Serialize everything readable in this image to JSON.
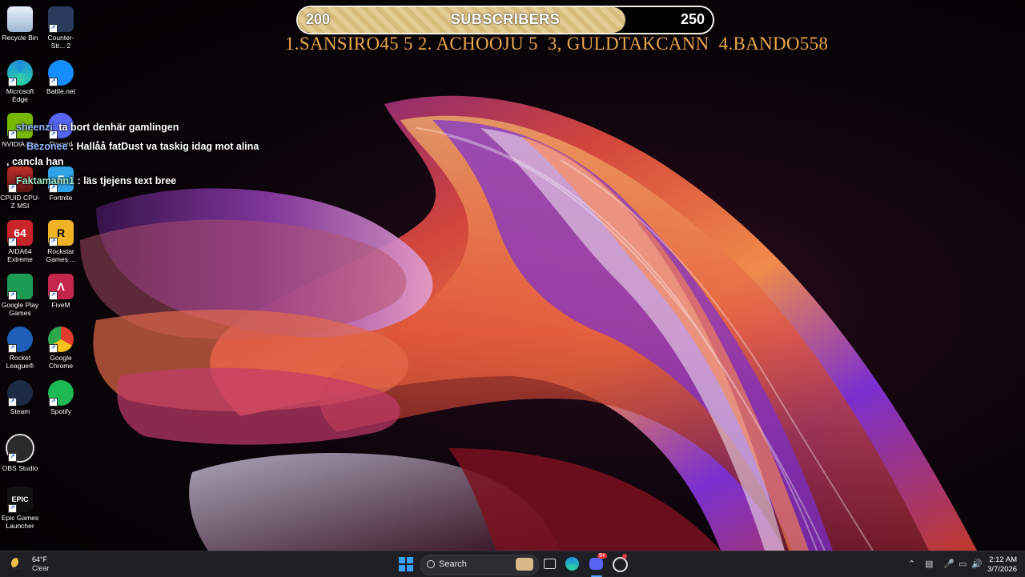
{
  "desktop_icons_left": [
    {
      "label": "Recycle Bin",
      "icon": "recycle-bin-icon"
    },
    {
      "label": "Microsoft Edge",
      "icon": "edge-icon"
    },
    {
      "label": "NVIDIA App",
      "icon": "nvidia-icon"
    },
    {
      "label": "CPUID CPU-Z MSI",
      "icon": "cpuz-icon"
    },
    {
      "label": "AIDA64 Extreme",
      "icon": "aida64-icon"
    },
    {
      "label": "Google Play Games",
      "icon": "google-play-games-icon"
    },
    {
      "label": "Rocket League®",
      "icon": "rocket-league-icon"
    },
    {
      "label": "Steam",
      "icon": "steam-icon"
    },
    {
      "label": "OBS Studio",
      "icon": "obs-icon"
    },
    {
      "label": "Epic Games Launcher",
      "icon": "epic-games-icon"
    }
  ],
  "desktop_icons_right": [
    {
      "label": "Counter-Str... 2",
      "icon": "counter-strike-icon"
    },
    {
      "label": "Battle.net",
      "icon": "battlenet-icon"
    },
    {
      "label": "Discord",
      "icon": "discord-icon"
    },
    {
      "label": "Fortnite",
      "icon": "fortnite-icon"
    },
    {
      "label": "Rockstar Games ...",
      "icon": "rockstar-icon"
    },
    {
      "label": "FiveM",
      "icon": "fivem-icon"
    },
    {
      "label": "Google Chrome",
      "icon": "chrome-icon"
    },
    {
      "label": "Spotify",
      "icon": "spotify-icon"
    }
  ],
  "overlay": {
    "left_value": "200",
    "title": "SUBSCRIBERS",
    "right_value": "250",
    "progress_fraction": 0.79,
    "fill_color": "#e4cd94"
  },
  "leaderboard": "1.SANSIRO45 5 2. ACHOOJU 5  3, GULDTAKCANN  4.BANDO558",
  "chat": [
    {
      "user": "sheenzi",
      "text": "ta bort denhär gamlingen"
    },
    {
      "user": "Bezonee",
      "text": ": Hallåå fatDust va taskig idag mot alina"
    },
    {
      "user": "",
      "text": ", cancla han"
    },
    {
      "user": "Faktamann1",
      "text": ": läs tjejens text bree"
    }
  ],
  "taskbar": {
    "weather_temp": "64°F",
    "weather_cond": "Clear",
    "search_label": "Search",
    "discord_badge": "9+",
    "time": "2:12 AM",
    "date": "3/7/2026"
  }
}
